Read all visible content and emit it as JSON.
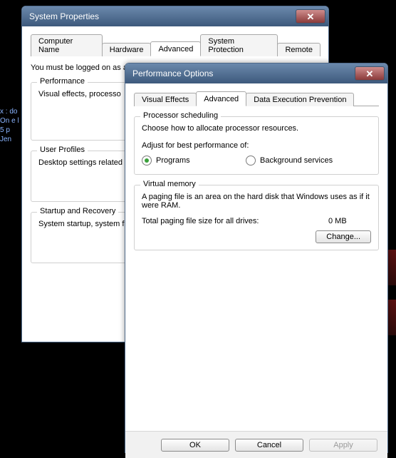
{
  "side_text": "x :\ndo\nOn\ne l\n5 p\nJen",
  "sysprops": {
    "title": "System Properties",
    "tabs": [
      "Computer Name",
      "Hardware",
      "Advanced",
      "System Protection",
      "Remote"
    ],
    "active_tab": 2,
    "admin_note": "You must be logged on as an Administrator to make most of these changes.",
    "perf": {
      "legend": "Performance",
      "text": "Visual effects, processo"
    },
    "profiles": {
      "legend": "User Profiles",
      "text": "Desktop settings related"
    },
    "startup": {
      "legend": "Startup and Recovery",
      "text": "System startup, system f"
    }
  },
  "perfopts": {
    "title": "Performance Options",
    "tabs": [
      "Visual Effects",
      "Advanced",
      "Data Execution Prevention"
    ],
    "active_tab": 1,
    "sched": {
      "legend": "Processor scheduling",
      "desc": "Choose how to allocate processor resources.",
      "adjust": "Adjust for best performance of:",
      "opt_programs": "Programs",
      "opt_bg": "Background services"
    },
    "vm": {
      "legend": "Virtual memory",
      "desc": "A paging file is an area on the hard disk that Windows uses as if it were RAM.",
      "total_label": "Total paging file size for all drives:",
      "total_value": "0 MB",
      "change": "Change..."
    },
    "buttons": {
      "ok": "OK",
      "cancel": "Cancel",
      "apply": "Apply"
    }
  }
}
